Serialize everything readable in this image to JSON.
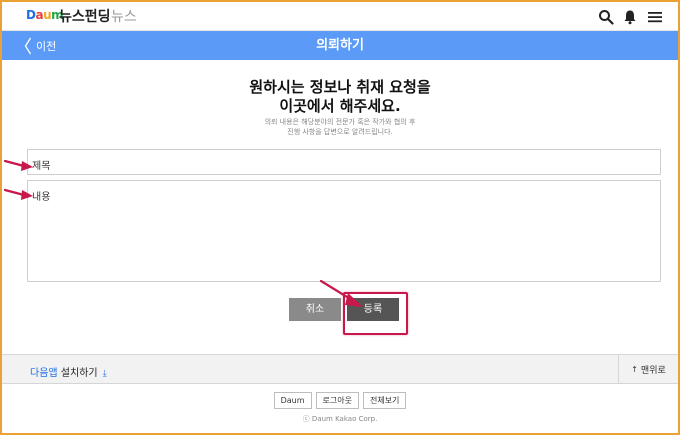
{
  "header": {
    "logo": {
      "d": "D",
      "a": "a",
      "u": "u",
      "m": "m"
    },
    "service": "뉴스펀딩",
    "subservice": "뉴스",
    "icons": [
      "search-icon",
      "bell-icon",
      "menu-icon"
    ]
  },
  "titlebar": {
    "back_label": "이전",
    "title": "의뢰하기"
  },
  "main": {
    "heading_line1": "원하시는 정보나 취재 요청을",
    "heading_line2": "이곳에서 해주세요.",
    "sub_line1": "의뢰 내용은 해당분야의 전문가 혹은 작가와 협의 후",
    "sub_line2": "진행 사항을 답변으로 알려드립니다.",
    "title_placeholder": "제목",
    "body_placeholder": "내용",
    "cancel_label": "취소",
    "submit_label": "등록"
  },
  "footer": {
    "install_app": "다음앱",
    "install_rest": " 설치하기",
    "to_top": "맨위로",
    "links": [
      "Daum",
      "로그아웃",
      "전체보기"
    ],
    "copyright": "ⓒ Daum Kakao Corp."
  },
  "colors": {
    "title_bar": "#5b9bf7",
    "annotation": "#c8174a",
    "cancel_btn": "#8a8a8a",
    "submit_btn": "#555555"
  }
}
